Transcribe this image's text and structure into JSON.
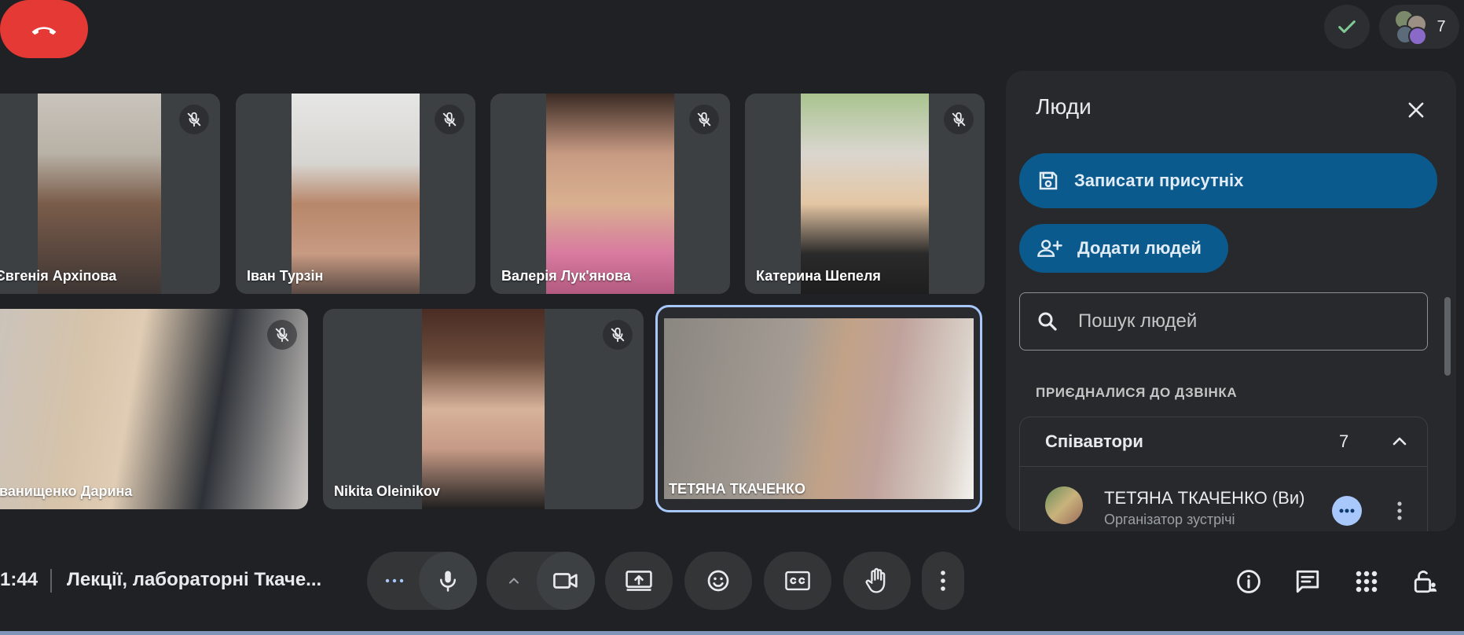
{
  "header": {
    "participants_count": "7"
  },
  "tiles": [
    {
      "name": "Євгенія Архіпова",
      "muted": true
    },
    {
      "name": "Іван Турзін",
      "muted": true
    },
    {
      "name": "Валерія Лук'янова",
      "muted": true
    },
    {
      "name": "Катерина Шепеля",
      "muted": true
    },
    {
      "name": "Іванищенко Дарина",
      "muted": true
    },
    {
      "name": "Nikita Oleinikov",
      "muted": true
    },
    {
      "name": "ТЕТЯНА ТКАЧЕНКО",
      "muted": false,
      "active": true
    }
  ],
  "panel": {
    "title": "Люди",
    "record_label": "Записати присутніх",
    "add_label": "Додати людей",
    "search_placeholder": "Пошук людей",
    "joined_heading": "ПРИЄДНАЛИСЯ ДО ДЗВІНКА",
    "group": {
      "label": "Співавтори",
      "count": "7",
      "members": [
        {
          "name": "ТЕТЯНА ТКАЧЕНКО (Ви)",
          "role": "Організатор зустрічі"
        }
      ]
    }
  },
  "bottom_bar": {
    "clock": "1:44",
    "meeting_title": "Лекції, лабораторні Ткаче..."
  },
  "colors": {
    "background": "#202124",
    "primary_button": "#0b5a8d",
    "hangup": "#e53935",
    "active_outline": "#a8c7fa",
    "check": "#81c995"
  }
}
